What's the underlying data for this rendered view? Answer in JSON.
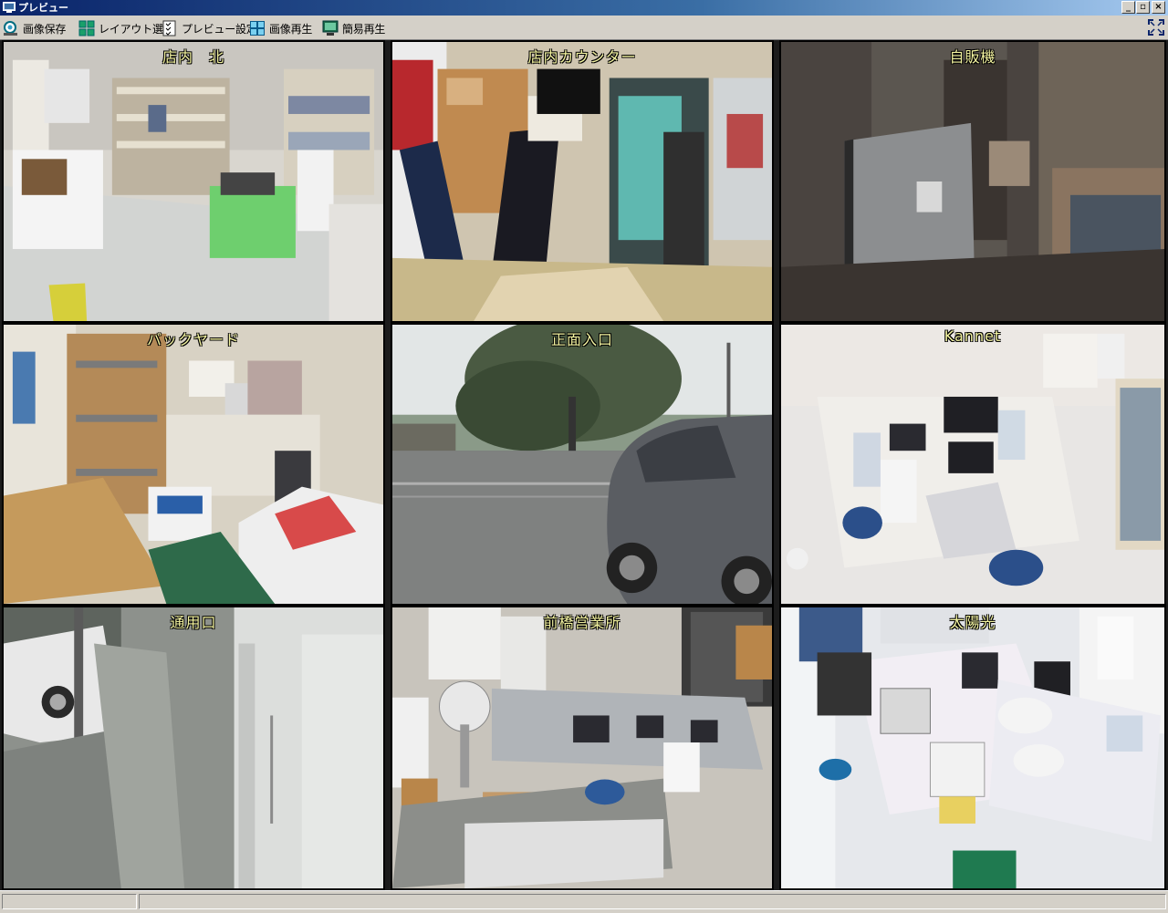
{
  "window": {
    "title": "プレビュー"
  },
  "toolbar": {
    "buttons": [
      {
        "label": "画像保存",
        "icon": "save-image-icon"
      },
      {
        "label": "レイアウト選択",
        "icon": "layout-grid-icon"
      },
      {
        "label": "プレビュー設定",
        "icon": "settings-list-icon"
      },
      {
        "label": "画像再生",
        "icon": "grid-playback-icon"
      },
      {
        "label": "簡易再生",
        "icon": "monitor-playback-icon"
      }
    ],
    "fullscreen_icon": "fullscreen-icon"
  },
  "cameras": [
    {
      "label": "店内　北"
    },
    {
      "label": "店内カウンター"
    },
    {
      "label": "自販機"
    },
    {
      "label": "バックヤード"
    },
    {
      "label": "正面入口"
    },
    {
      "label": "Kannet"
    },
    {
      "label": "通用口"
    },
    {
      "label": "前橋営業所"
    },
    {
      "label": "太陽光"
    }
  ],
  "status": {
    "pane1": "",
    "pane2": ""
  }
}
